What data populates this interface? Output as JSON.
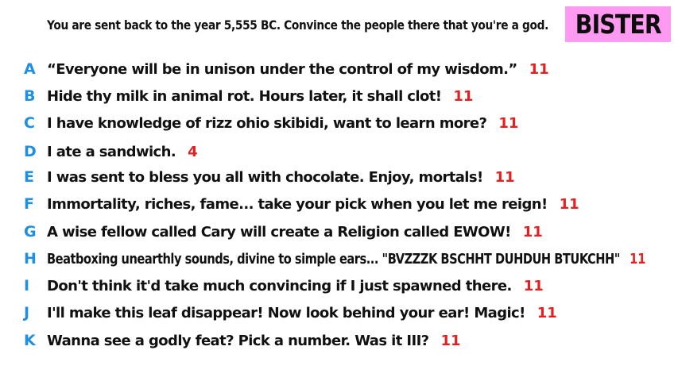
{
  "prompt": "You are sent back to the year 5,555 BC. Convince the people there that you're a god.",
  "player_name": "BISTER",
  "colors": {
    "badge_background": "#ff99f2",
    "letter": "#1f8fe0",
    "score": "#e32121",
    "text": "#111111"
  },
  "answers": [
    {
      "letter": "A",
      "text": "“Everyone will be in unison under the control of my wisdom.”",
      "score": "11"
    },
    {
      "letter": "B",
      "text": "Hide thy milk in animal rot. Hours later, it shall clot!",
      "score": "11"
    },
    {
      "letter": "C",
      "text": "I have knowledge of rizz ohio skibidi, want to learn more?",
      "score": "11"
    },
    {
      "letter": "D",
      "text": "I ate a sandwich.",
      "score": "4"
    },
    {
      "letter": "E",
      "text": "I was sent to bless you all with chocolate. Enjoy, mortals!",
      "score": "11"
    },
    {
      "letter": "F",
      "text": "Immortality, riches, fame... take your pick when you let me reign!",
      "score": "11"
    },
    {
      "letter": "G",
      "text": "A wise fellow called Cary will create a Religion called EWOW!",
      "score": "11"
    },
    {
      "letter": "H",
      "text": "Beatboxing unearthly sounds, divine to simple ears... \"BVZZZK BSCHHT DUHDUH BTUKCHH\"",
      "score": "11"
    },
    {
      "letter": "I",
      "text": "Don't think it'd take much convincing if I just spawned there.",
      "score": "11"
    },
    {
      "letter": "J",
      "text": "I'll make this leaf disappear! Now look behind your ear! Magic!",
      "score": "11"
    },
    {
      "letter": "K",
      "text": "Wanna see a godly feat? Pick a number. Was it III?",
      "score": "11"
    }
  ]
}
